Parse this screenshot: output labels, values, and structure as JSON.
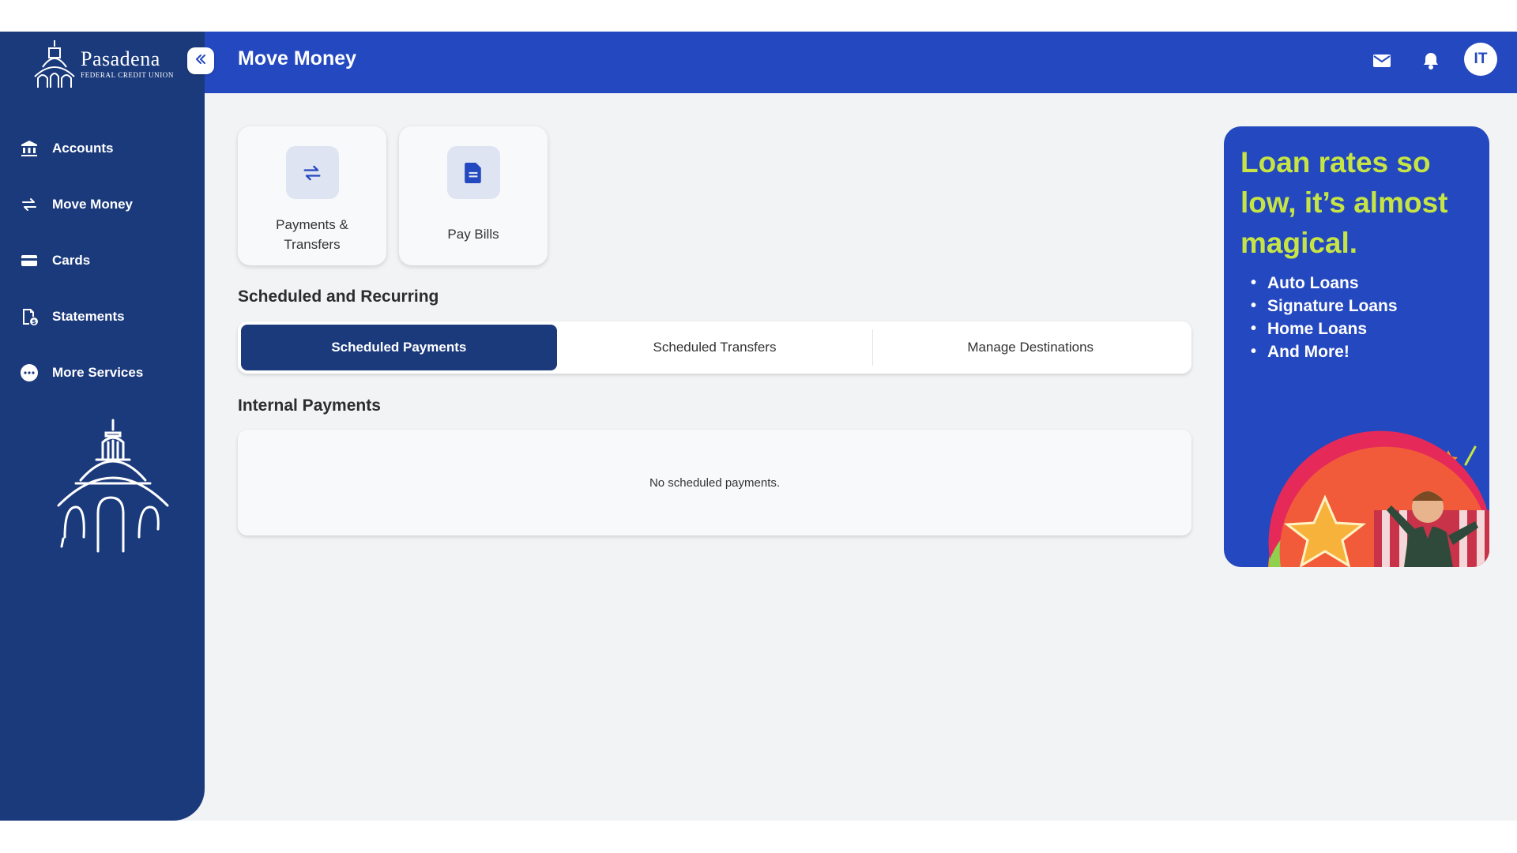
{
  "brand": {
    "name": "Pasadena",
    "subtitle": "FEDERAL CREDIT UNION"
  },
  "sidebar": {
    "items": [
      {
        "label": "Accounts",
        "icon": "bank-icon"
      },
      {
        "label": "Move Money",
        "icon": "transfer-arrows-icon"
      },
      {
        "label": "Cards",
        "icon": "card-icon"
      },
      {
        "label": "Statements",
        "icon": "statement-icon"
      },
      {
        "label": "More Services",
        "icon": "more-dots-icon"
      }
    ]
  },
  "header": {
    "title": "Move Money",
    "avatar_initials": "IT"
  },
  "tiles": [
    {
      "label": "Payments & Transfers",
      "icon": "transfer-arrows-icon"
    },
    {
      "label": "Pay Bills",
      "icon": "document-icon"
    }
  ],
  "scheduled": {
    "title": "Scheduled and Recurring",
    "tabs": [
      "Scheduled Payments",
      "Scheduled Transfers",
      "Manage Destinations"
    ],
    "active_tab": "Scheduled Payments"
  },
  "internal": {
    "title": "Internal Payments",
    "empty_message": "No scheduled payments."
  },
  "promo": {
    "headline": "Loan rates so low, it’s almost magical.",
    "items": [
      "Auto Loans",
      "Signature Loans",
      "Home Loans",
      "And More!"
    ]
  },
  "colors": {
    "sidebar": "#1b3a7c",
    "header": "#2448bf",
    "accent_green": "#c6e544",
    "background": "#f2f3f5"
  }
}
